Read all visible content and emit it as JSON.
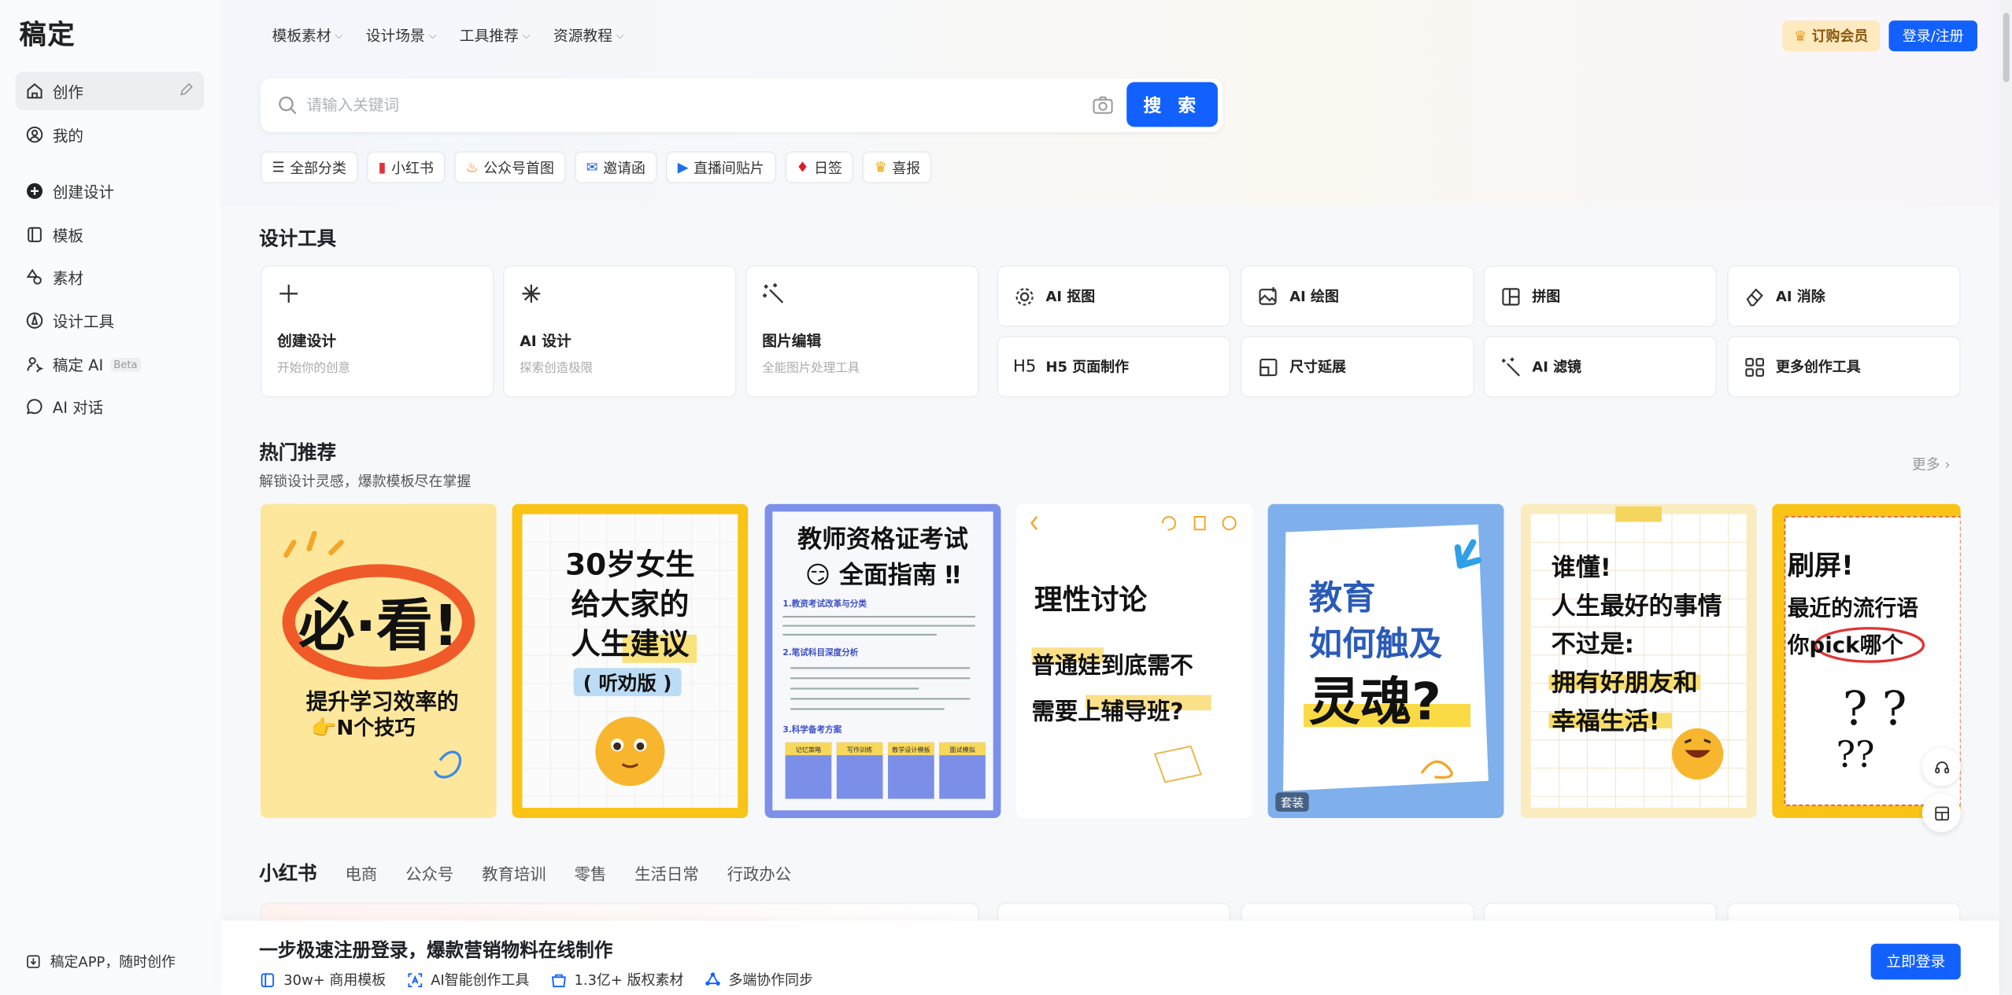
{
  "app": {
    "logo": "稿定"
  },
  "sidebar": {
    "items": [
      {
        "label": "创作",
        "icon": "home-icon"
      },
      {
        "label": "我的",
        "icon": "user-icon"
      },
      {
        "label": "创建设计",
        "icon": "plus-circle-icon"
      },
      {
        "label": "模板",
        "icon": "template-icon"
      },
      {
        "label": "素材",
        "icon": "shapes-icon"
      },
      {
        "label": "设计工具",
        "icon": "compass-icon"
      },
      {
        "label": "稿定 AI",
        "icon": "ai-icon",
        "badge": "Beta"
      },
      {
        "label": "AI 对话",
        "icon": "chat-icon"
      }
    ],
    "app_download": "稿定APP，随时创作"
  },
  "topnav": {
    "items": [
      "模板素材",
      "设计场景",
      "工具推荐",
      "资源教程"
    ]
  },
  "header": {
    "vip_label": "订购会员",
    "login_label": "登录/注册"
  },
  "search": {
    "placeholder": "请输入关键词",
    "button": "搜 索"
  },
  "chips": [
    {
      "label": "全部分类",
      "icon": "menu-icon"
    },
    {
      "label": "小红书",
      "icon": "book-icon"
    },
    {
      "label": "公众号首图",
      "icon": "flame-icon"
    },
    {
      "label": "邀请函",
      "icon": "envelope-icon"
    },
    {
      "label": "直播间贴片",
      "icon": "play-icon"
    },
    {
      "label": "日签",
      "icon": "pin-icon"
    },
    {
      "label": "喜报",
      "icon": "trophy-icon"
    }
  ],
  "design_tools": {
    "title": "设计工具",
    "big": [
      {
        "title": "创建设计",
        "sub": "开始你的创意",
        "icon": "plus-icon"
      },
      {
        "title": "AI 设计",
        "sub": "探索创造极限",
        "icon": "sparkle-icon"
      },
      {
        "title": "图片编辑",
        "sub": "全能图片处理工具",
        "icon": "magic-wand-icon"
      }
    ],
    "small": [
      {
        "title": "AI 抠图",
        "icon": "cutout-icon"
      },
      {
        "title": "AI 绘图",
        "icon": "image-ai-icon"
      },
      {
        "title": "拼图",
        "icon": "collage-icon"
      },
      {
        "title": "AI 消除",
        "icon": "eraser-icon"
      },
      {
        "title": "H5 页面制作",
        "icon": "h5-icon"
      },
      {
        "title": "尺寸延展",
        "icon": "resize-icon"
      },
      {
        "title": "AI 滤镜",
        "icon": "filter-wand-icon"
      },
      {
        "title": "更多创作工具",
        "icon": "grid-icon"
      }
    ]
  },
  "hot": {
    "title": "热门推荐",
    "subtitle": "解锁设计灵感，爆款模板尽在掌握",
    "more": "更多 ›",
    "templates": [
      {
        "lines": [
          "必·看!",
          "提升学习效率的",
          "👉N个技巧"
        ]
      },
      {
        "lines": [
          "30岁女生",
          "给大家的",
          "人生建议",
          "( 听劝版 )"
        ]
      },
      {
        "lines": [
          "教师资格证考试",
          "😏 全面指南 ‼",
          "1.教资考试改革与分类",
          "2.笔试科目深度分析",
          "3.科学备考方案",
          "记忆策略",
          "写作训练",
          "教学设计模板",
          "面试模拟"
        ]
      },
      {
        "lines": [
          "理性讨论",
          "普通娃到底需不",
          "需要上辅导班?"
        ]
      },
      {
        "lines": [
          "教育",
          "如何触及",
          "灵魂?"
        ],
        "badge": "套装"
      },
      {
        "lines": [
          "谁懂!",
          "人生最好的事情",
          "不过是:",
          "拥有好朋友和",
          "幸福生活!"
        ]
      },
      {
        "lines": [
          "刷屏!",
          "最近的流行语",
          "你pick哪个"
        ]
      }
    ]
  },
  "categories": [
    "小红书",
    "电商",
    "公众号",
    "教育培训",
    "零售",
    "生活日常",
    "行政办公"
  ],
  "bottom_bar": {
    "title": "一步极速注册登录，爆款营销物料在线制作",
    "features": [
      {
        "label": "30w+ 商用模板",
        "icon": "template-icon"
      },
      {
        "label": "AI智能创作工具",
        "icon": "ai-icon"
      },
      {
        "label": "1.3亿+ 版权素材",
        "icon": "shop-icon"
      },
      {
        "label": "多端协作同步",
        "icon": "sync-icon"
      }
    ],
    "button": "立即登录"
  },
  "colors": {
    "accent": "#1261ff",
    "vip_bg": "#ffe9bf",
    "page_bg": "#f6f8fa"
  }
}
